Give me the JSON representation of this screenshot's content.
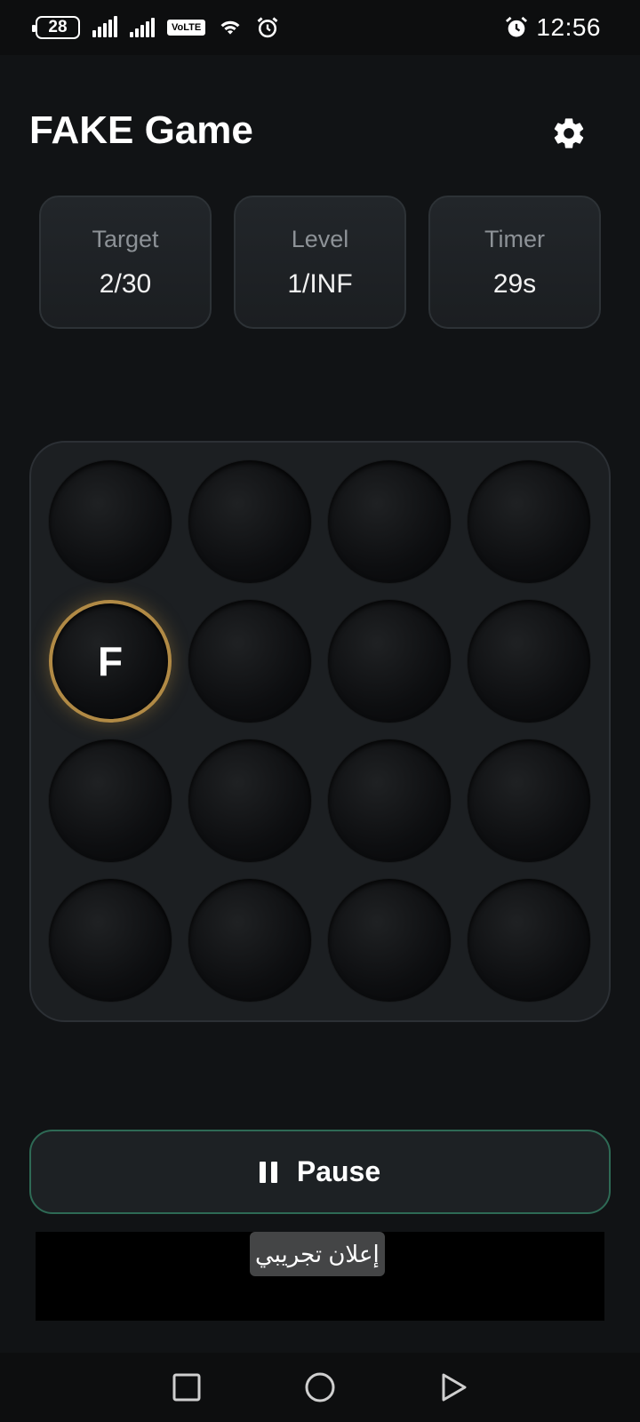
{
  "status_bar": {
    "battery": "28",
    "network_type": "VoLTE",
    "time": "12:56"
  },
  "app": {
    "title": "FAKE Game",
    "settings_icon": "gear-icon"
  },
  "stats": [
    {
      "label": "Target",
      "value": "2/30"
    },
    {
      "label": "Level",
      "value": "1/INF"
    },
    {
      "label": "Timer",
      "value": "29s"
    }
  ],
  "board": {
    "rows": 4,
    "cols": 4,
    "cells": [
      {
        "letter": "",
        "active": false
      },
      {
        "letter": "",
        "active": false
      },
      {
        "letter": "",
        "active": false
      },
      {
        "letter": "",
        "active": false
      },
      {
        "letter": "F",
        "active": true
      },
      {
        "letter": "",
        "active": false
      },
      {
        "letter": "",
        "active": false
      },
      {
        "letter": "",
        "active": false
      },
      {
        "letter": "",
        "active": false
      },
      {
        "letter": "",
        "active": false
      },
      {
        "letter": "",
        "active": false
      },
      {
        "letter": "",
        "active": false
      },
      {
        "letter": "",
        "active": false
      },
      {
        "letter": "",
        "active": false
      },
      {
        "letter": "",
        "active": false
      },
      {
        "letter": "",
        "active": false
      }
    ],
    "active_border_color": "#b18a45"
  },
  "controls": {
    "pause_label": "Pause",
    "pause_icon": "pause-icon",
    "accent_color": "#2e6a55"
  },
  "ad": {
    "tag": "إعلان تجريبي"
  },
  "nav": {
    "recents_icon": "square-icon",
    "home_icon": "circle-icon",
    "back_icon": "triangle-icon"
  }
}
